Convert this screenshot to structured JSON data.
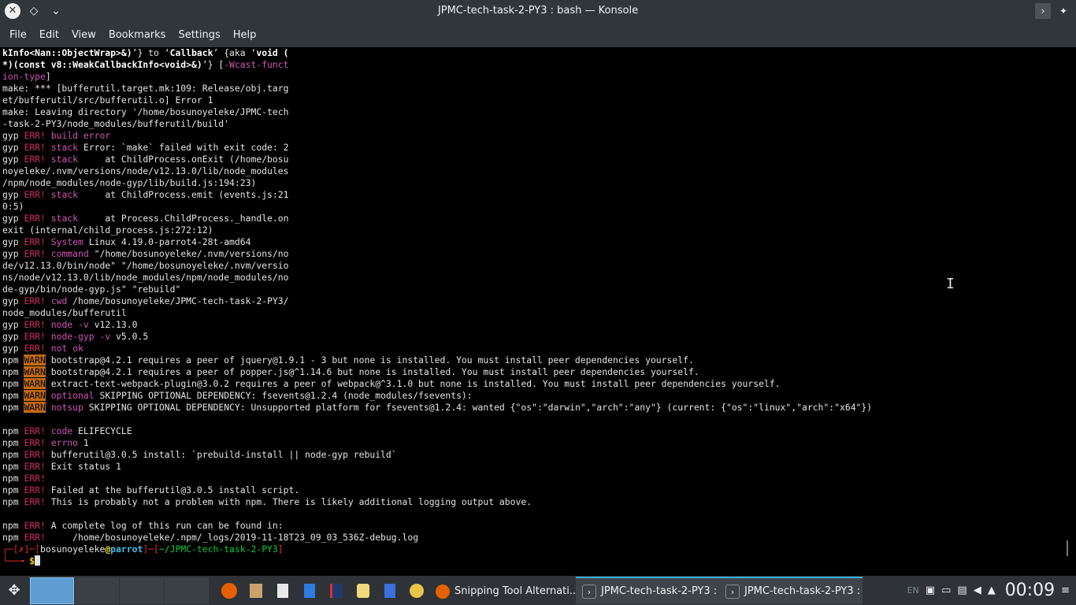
{
  "window": {
    "title": "JPMC-tech-task-2-PY3 : bash — Konsole",
    "app_icon": "konsole-close-icon"
  },
  "menu": [
    "File",
    "Edit",
    "View",
    "Bookmarks",
    "Settings",
    "Help"
  ],
  "terminal": {
    "lines": [
      [
        {
          "t": "kInfo<Nan::ObjectWrap>&)",
          "c": "bold"
        },
        {
          "t": "’} to ‘"
        },
        {
          "t": "Callback",
          "c": "bold"
        },
        {
          "t": "’ {aka ‘"
        },
        {
          "t": "void (",
          "c": "bold"
        }
      ],
      [
        {
          "t": "*)(const v8::WeakCallbackInfo<void>&)",
          "c": "bold"
        },
        {
          "t": "’} ["
        },
        {
          "t": "-Wcast-funct",
          "c": "mag"
        }
      ],
      [
        {
          "t": "ion-type",
          "c": "mag"
        },
        {
          "t": "]"
        }
      ],
      [
        {
          "t": "make: *** [bufferutil.target.mk:109: Release/obj.targ"
        }
      ],
      [
        {
          "t": "et/bufferutil/src/bufferutil.o] Error 1"
        }
      ],
      [
        {
          "t": "make: Leaving directory '/home/bosunoyeleke/JPMC-tech"
        }
      ],
      [
        {
          "t": "-task-2-PY3/node_modules/bufferutil/build'"
        }
      ],
      [
        {
          "t": "gyp "
        },
        {
          "t": "ERR!",
          "c": "err"
        },
        {
          "t": " "
        },
        {
          "t": "build error",
          "c": "mag"
        }
      ],
      [
        {
          "t": "gyp "
        },
        {
          "t": "ERR!",
          "c": "err"
        },
        {
          "t": " "
        },
        {
          "t": "stack",
          "c": "mag"
        },
        {
          "t": " Error: `make` failed with exit code: 2"
        }
      ],
      [
        {
          "t": "gyp "
        },
        {
          "t": "ERR!",
          "c": "err"
        },
        {
          "t": " "
        },
        {
          "t": "stack",
          "c": "mag"
        },
        {
          "t": "     at ChildProcess.onExit (/home/bosu"
        }
      ],
      [
        {
          "t": "noyeleke/.nvm/versions/node/v12.13.0/lib/node_modules"
        }
      ],
      [
        {
          "t": "/npm/node_modules/node-gyp/lib/build.js:194:23)"
        }
      ],
      [
        {
          "t": "gyp "
        },
        {
          "t": "ERR!",
          "c": "err"
        },
        {
          "t": " "
        },
        {
          "t": "stack",
          "c": "mag"
        },
        {
          "t": "     at ChildProcess.emit (events.js:21"
        }
      ],
      [
        {
          "t": "0:5)"
        }
      ],
      [
        {
          "t": "gyp "
        },
        {
          "t": "ERR!",
          "c": "err"
        },
        {
          "t": " "
        },
        {
          "t": "stack",
          "c": "mag"
        },
        {
          "t": "     at Process.ChildProcess._handle.on"
        }
      ],
      [
        {
          "t": "exit (internal/child_process.js:272:12)"
        }
      ],
      [
        {
          "t": "gyp "
        },
        {
          "t": "ERR!",
          "c": "err"
        },
        {
          "t": " "
        },
        {
          "t": "System",
          "c": "mag"
        },
        {
          "t": " Linux 4.19.0-parrot4-28t-amd64"
        }
      ],
      [
        {
          "t": "gyp "
        },
        {
          "t": "ERR!",
          "c": "err"
        },
        {
          "t": " "
        },
        {
          "t": "command",
          "c": "mag"
        },
        {
          "t": " \"/home/bosunoyeleke/.nvm/versions/no"
        }
      ],
      [
        {
          "t": "de/v12.13.0/bin/node\" \"/home/bosunoyeleke/.nvm/versio"
        }
      ],
      [
        {
          "t": "ns/node/v12.13.0/lib/node_modules/npm/node_modules/no"
        }
      ],
      [
        {
          "t": "de-gyp/bin/node-gyp.js\" \"rebuild\""
        }
      ],
      [
        {
          "t": "gyp "
        },
        {
          "t": "ERR!",
          "c": "err"
        },
        {
          "t": " "
        },
        {
          "t": "cwd",
          "c": "mag"
        },
        {
          "t": " /home/bosunoyeleke/JPMC-tech-task-2-PY3/"
        }
      ],
      [
        {
          "t": "node_modules/bufferutil"
        }
      ],
      [
        {
          "t": "gyp "
        },
        {
          "t": "ERR!",
          "c": "err"
        },
        {
          "t": " "
        },
        {
          "t": "node -v",
          "c": "mag"
        },
        {
          "t": " v12.13.0"
        }
      ],
      [
        {
          "t": "gyp "
        },
        {
          "t": "ERR!",
          "c": "err"
        },
        {
          "t": " "
        },
        {
          "t": "node-gyp -v",
          "c": "mag"
        },
        {
          "t": " v5.0.5"
        }
      ],
      [
        {
          "t": "gyp "
        },
        {
          "t": "ERR!",
          "c": "err"
        },
        {
          "t": " "
        },
        {
          "t": "not ok",
          "c": "mag"
        }
      ],
      [
        {
          "t": "npm "
        },
        {
          "t": "WARN",
          "c": "warn"
        },
        {
          "t": " bootstrap@4.2.1 requires a peer of jquery@1.9.1 - 3 but none is installed. You must install peer dependencies yourself."
        }
      ],
      [
        {
          "t": "npm "
        },
        {
          "t": "WARN",
          "c": "warn"
        },
        {
          "t": " bootstrap@4.2.1 requires a peer of popper.js@^1.14.6 but none is installed. You must install peer dependencies yourself."
        }
      ],
      [
        {
          "t": "npm "
        },
        {
          "t": "WARN",
          "c": "warn"
        },
        {
          "t": " extract-text-webpack-plugin@3.0.2 requires a peer of webpack@^3.1.0 but none is installed. You must install peer dependencies yourself."
        }
      ],
      [
        {
          "t": "npm "
        },
        {
          "t": "WARN",
          "c": "warn"
        },
        {
          "t": " "
        },
        {
          "t": "optional",
          "c": "mag"
        },
        {
          "t": " SKIPPING OPTIONAL DEPENDENCY: fsevents@1.2.4 (node_modules/fsevents):"
        }
      ],
      [
        {
          "t": "npm "
        },
        {
          "t": "WARN",
          "c": "warn"
        },
        {
          "t": " "
        },
        {
          "t": "notsup",
          "c": "mag"
        },
        {
          "t": " SKIPPING OPTIONAL DEPENDENCY: Unsupported platform for fsevents@1.2.4: wanted {\"os\":\"darwin\",\"arch\":\"any\"} (current: {\"os\":\"linux\",\"arch\":\"x64\"})"
        }
      ],
      [],
      [
        {
          "t": "npm "
        },
        {
          "t": "ERR!",
          "c": "err"
        },
        {
          "t": " "
        },
        {
          "t": "code",
          "c": "mag"
        },
        {
          "t": " ELIFECYCLE"
        }
      ],
      [
        {
          "t": "npm "
        },
        {
          "t": "ERR!",
          "c": "err"
        },
        {
          "t": " "
        },
        {
          "t": "errno",
          "c": "mag"
        },
        {
          "t": " 1"
        }
      ],
      [
        {
          "t": "npm "
        },
        {
          "t": "ERR!",
          "c": "err"
        },
        {
          "t": " bufferutil@3.0.5 install: `prebuild-install || node-gyp rebuild`"
        }
      ],
      [
        {
          "t": "npm "
        },
        {
          "t": "ERR!",
          "c": "err"
        },
        {
          "t": " Exit status 1"
        }
      ],
      [
        {
          "t": "npm "
        },
        {
          "t": "ERR!",
          "c": "err"
        }
      ],
      [
        {
          "t": "npm "
        },
        {
          "t": "ERR!",
          "c": "err"
        },
        {
          "t": " Failed at the bufferutil@3.0.5 install script."
        }
      ],
      [
        {
          "t": "npm "
        },
        {
          "t": "ERR!",
          "c": "err"
        },
        {
          "t": " This is probably not a problem with npm. There is likely additional logging output above."
        }
      ],
      [],
      [
        {
          "t": "npm "
        },
        {
          "t": "ERR!",
          "c": "err"
        },
        {
          "t": " A complete log of this run can be found in:"
        }
      ],
      [
        {
          "t": "npm "
        },
        {
          "t": "ERR!",
          "c": "err"
        },
        {
          "t": "     /home/bosunoyeleke/.npm/_logs/2019-11-18T23_09_03_536Z-debug.log"
        }
      ],
      [
        {
          "t": "┌─[",
          "c": "prompt-red"
        },
        {
          "t": "✗",
          "c": "prompt-red"
        },
        {
          "t": "]─[",
          "c": "prompt-red"
        },
        {
          "t": "bosunoyeleke"
        },
        {
          "t": "@",
          "c": "prompt-dollar"
        },
        {
          "t": "parrot",
          "c": "prompt-host"
        },
        {
          "t": "]─[",
          "c": "prompt-red"
        },
        {
          "t": "~/JPMC-tech-task-2-PY3",
          "c": "prompt-green"
        },
        {
          "t": "]",
          "c": "prompt-red"
        }
      ],
      [
        {
          "t": "└──╼ ",
          "c": "prompt-red"
        },
        {
          "t": "$",
          "c": "prompt-dollar"
        },
        {
          "t": "",
          "c": "cursor"
        }
      ]
    ]
  },
  "taskbar": {
    "tasks": [
      {
        "label": "Snipping Tool Alternati...",
        "icon": "firefox-icon",
        "color": "#e66000",
        "active": false
      },
      {
        "label": "JPMC-tech-task-2-PY3 : ...",
        "icon": "terminal-icon",
        "color": "#3b4046",
        "active": true
      },
      {
        "label": "JPMC-tech-task-2-PY3 : ...",
        "icon": "terminal-icon",
        "color": "#3b4046",
        "active": true
      }
    ],
    "tray_lang": "EN",
    "clock": "00:09"
  }
}
